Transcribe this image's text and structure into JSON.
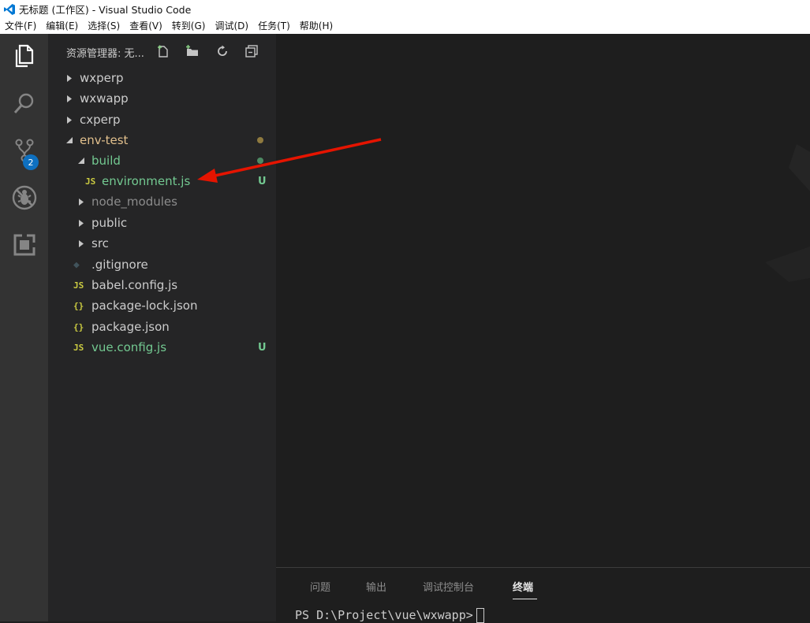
{
  "window": {
    "title": "无标题 (工作区) - Visual Studio Code"
  },
  "menu": [
    "文件(F)",
    "编辑(E)",
    "选择(S)",
    "查看(V)",
    "转到(G)",
    "调试(D)",
    "任务(T)",
    "帮助(H)"
  ],
  "activity": {
    "scm_badge": "2"
  },
  "explorer": {
    "title": "资源管理器: 无...",
    "tree": [
      {
        "label": "wxperp",
        "type": "folder",
        "expanded": false,
        "depth": 0
      },
      {
        "label": "wxwapp",
        "type": "folder",
        "expanded": false,
        "depth": 0
      },
      {
        "label": "cxperp",
        "type": "folder",
        "expanded": false,
        "depth": 0
      },
      {
        "label": "env-test",
        "type": "folder",
        "expanded": true,
        "depth": 0
      },
      {
        "label": "build",
        "type": "folder",
        "expanded": true,
        "depth": 1
      },
      {
        "label": "environment.js",
        "type": "file",
        "icon": "JS",
        "depth": 2,
        "decoration": "U"
      },
      {
        "label": "node_modules",
        "type": "folder",
        "expanded": false,
        "depth": 1
      },
      {
        "label": "public",
        "type": "folder",
        "expanded": false,
        "depth": 1
      },
      {
        "label": "src",
        "type": "folder",
        "expanded": false,
        "depth": 1
      },
      {
        "label": ".gitignore",
        "type": "file",
        "icon": "◆",
        "depth": 1
      },
      {
        "label": "babel.config.js",
        "type": "file",
        "icon": "JS",
        "depth": 1
      },
      {
        "label": "package-lock.json",
        "type": "file",
        "icon": "{}",
        "depth": 1
      },
      {
        "label": "package.json",
        "type": "file",
        "icon": "{}",
        "depth": 1
      },
      {
        "label": "vue.config.js",
        "type": "file",
        "icon": "JS",
        "depth": 1,
        "decoration": "U"
      }
    ]
  },
  "panel": {
    "tabs": [
      "问题",
      "输出",
      "调试控制台",
      "终端"
    ],
    "active_tab": "终端",
    "terminal_prompt": "PS D:\\Project\\vue\\wxwapp>"
  },
  "colors": {
    "untracked": "#73c991",
    "modified": "#e2c08d",
    "js_icon": "#cbcb41",
    "json_icon": "#cbcb41",
    "arrow": "#e51400"
  }
}
